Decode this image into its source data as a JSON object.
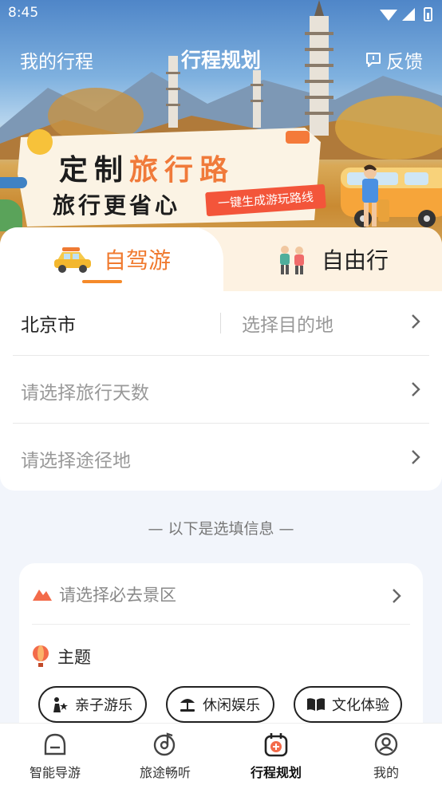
{
  "status_bar": {
    "time": "8:45"
  },
  "header": {
    "left": "我的行程",
    "title": "行程规划",
    "feedback": "反馈"
  },
  "banner": {
    "line1_a": "定制",
    "line1_b": "旅行路",
    "line2": "旅行更省心",
    "pill": "一键生成游玩路线"
  },
  "tabs": [
    {
      "label": "自驾游",
      "icon": "car-icon",
      "active": true
    },
    {
      "label": "自由行",
      "icon": "hikers-icon",
      "active": false
    }
  ],
  "form": {
    "origin": "北京市",
    "destination_placeholder": "选择目的地",
    "days_placeholder": "请选择旅行天数",
    "waypoints_placeholder": "请选择途径地"
  },
  "optional_label": "— 以下是选填信息 —",
  "optional": {
    "scenic_placeholder": "请选择必去景区",
    "theme_label": "主题",
    "themes": [
      {
        "label": "亲子游乐",
        "icon": "family-icon"
      },
      {
        "label": "休闲娱乐",
        "icon": "beach-icon"
      },
      {
        "label": "文化体验",
        "icon": "book-icon"
      }
    ]
  },
  "bottom_nav": [
    {
      "label": "智能导游",
      "icon": "guide-icon"
    },
    {
      "label": "旅途畅听",
      "icon": "audio-icon"
    },
    {
      "label": "行程规划",
      "icon": "calendar-plus-icon",
      "active": true
    },
    {
      "label": "我的",
      "icon": "user-icon"
    }
  ],
  "colors": {
    "accent": "#f07a2f",
    "pill": "#f3553a",
    "tab_inactive_bg": "#fdf2e2"
  }
}
